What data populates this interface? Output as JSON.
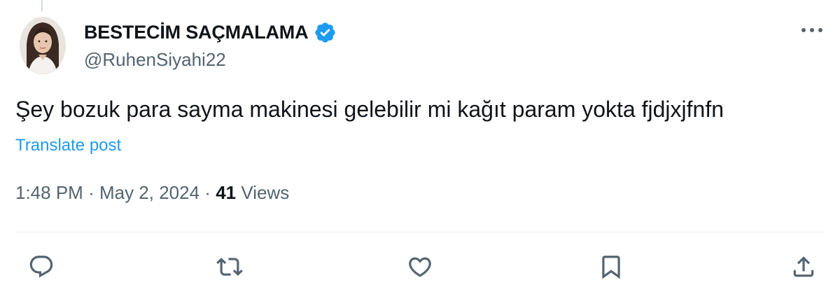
{
  "author": {
    "display_name": "BESTECİM SAÇMALAMA",
    "handle": "@RuhenSiyahi22",
    "verified": true,
    "avatar_icon": "profile-photo-avatar"
  },
  "post": {
    "text": "Şey bozuk para sayma makinesi gelebilir mi kağıt param yokta fjdjxjfnfn",
    "translate_label": "Translate post"
  },
  "meta": {
    "time": "1:48 PM",
    "separator": "·",
    "date": "May 2, 2024",
    "views_count": "41",
    "views_label": "Views"
  },
  "actions": {
    "reply_icon": "reply-icon",
    "repost_icon": "repost-icon",
    "like_icon": "heart-icon",
    "bookmark_icon": "bookmark-icon",
    "share_icon": "share-icon"
  },
  "colors": {
    "text_primary": "#0f1419",
    "text_secondary": "#536471",
    "link": "#1d9bf0",
    "verified": "#1d9bf0",
    "divider": "#eff3f4"
  }
}
